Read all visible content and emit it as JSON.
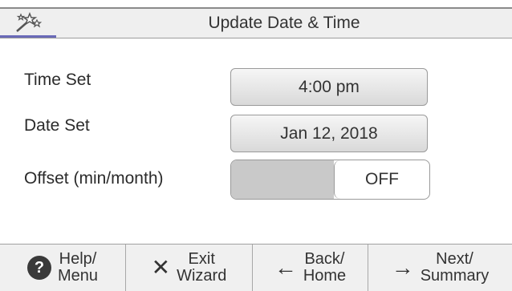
{
  "header": {
    "title": "Update Date & Time",
    "icon": "wand-icon"
  },
  "settings": {
    "time": {
      "label": "Time Set",
      "value": "4:00 pm"
    },
    "date": {
      "label": "Date Set",
      "value": "Jan 12, 2018"
    },
    "offset": {
      "label": "Offset (min/month)",
      "state": "OFF"
    }
  },
  "footer": {
    "help": {
      "line1": "Help/",
      "line2": "Menu",
      "icon": "help-icon"
    },
    "exit": {
      "line1": "Exit",
      "line2": "Wizard",
      "icon": "close-icon"
    },
    "back": {
      "line1": "Back/",
      "line2": "Home",
      "icon": "arrow-left-icon"
    },
    "next": {
      "line1": "Next/",
      "line2": "Summary",
      "icon": "arrow-right-icon"
    }
  },
  "colors": {
    "accent": "#6a6ab8",
    "header_bg": "#efefef",
    "footer_bg": "#f0f0f0"
  }
}
